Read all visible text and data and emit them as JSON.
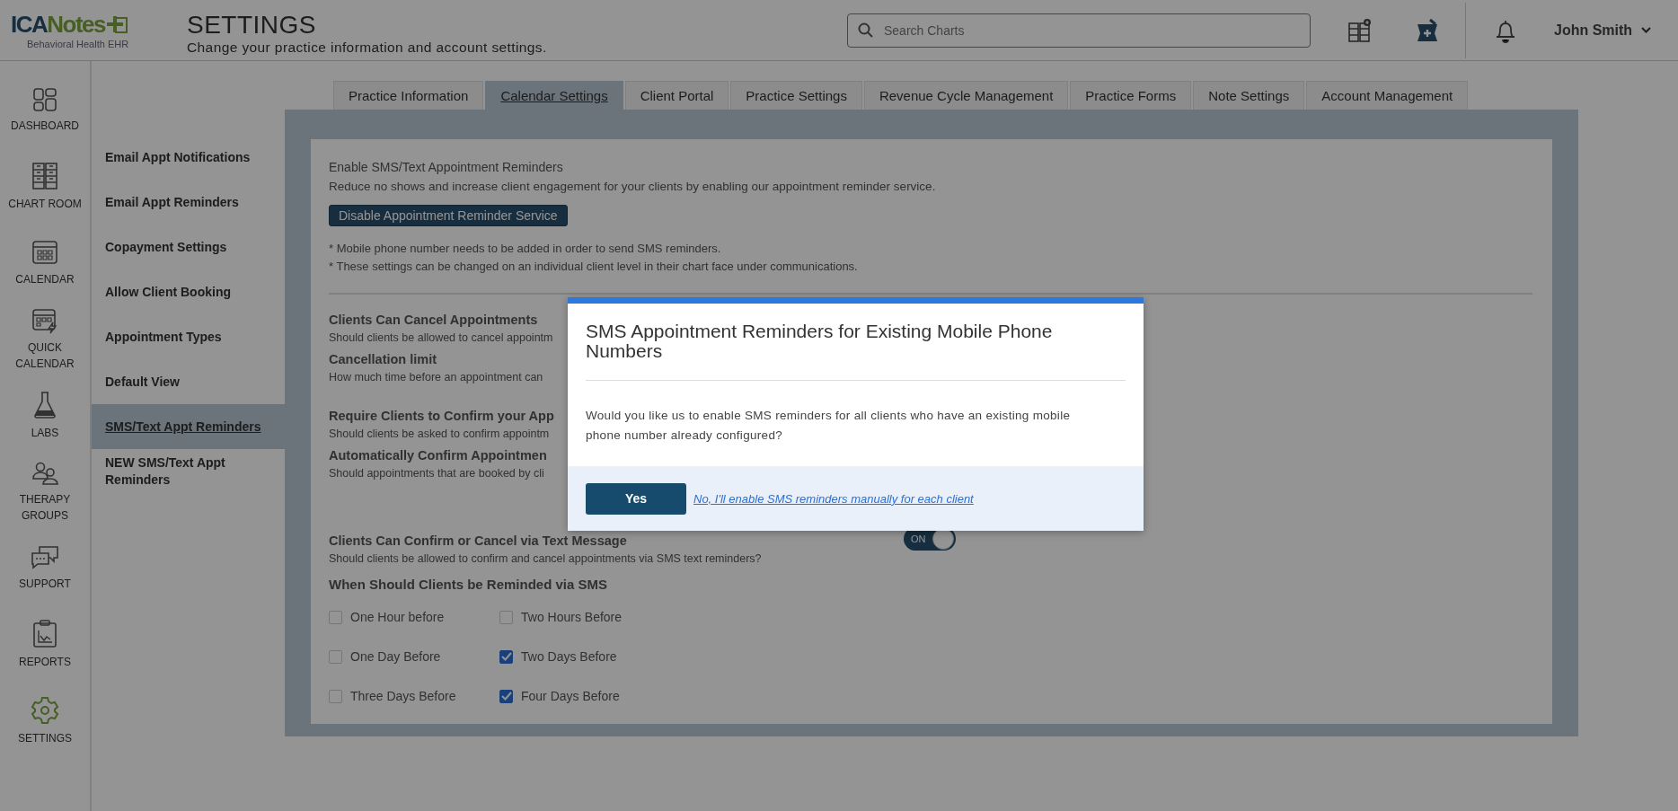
{
  "header": {
    "logo_primary": "ICA",
    "logo_secondary": "Notes",
    "tagline": "Behavioral Health EHR",
    "title": "SETTINGS",
    "subtitle": "Change your practice information and account settings.",
    "search": {
      "placeholder": "Search Charts"
    },
    "user": "John Smith"
  },
  "nav": [
    {
      "label": "DASHBOARD",
      "selected": false
    },
    {
      "label": "CHART ROOM",
      "selected": false
    },
    {
      "label": "CALENDAR",
      "selected": false
    },
    {
      "label": "QUICK CALENDAR",
      "selected": false
    },
    {
      "label": "LABS",
      "selected": false
    },
    {
      "label": "THERAPY GROUPS",
      "selected": false
    },
    {
      "label": "SUPPORT",
      "selected": false
    },
    {
      "label": "REPORTS",
      "selected": false
    },
    {
      "label": "SETTINGS",
      "selected": true
    }
  ],
  "tabs": [
    {
      "label": "Practice Information",
      "selected": false
    },
    {
      "label": "Calendar Settings",
      "selected": true
    },
    {
      "label": "Client Portal",
      "selected": false
    },
    {
      "label": "Practice Settings",
      "selected": false
    },
    {
      "label": "Revenue Cycle Management",
      "selected": false
    },
    {
      "label": "Practice Forms",
      "selected": false
    },
    {
      "label": "Note Settings",
      "selected": false
    },
    {
      "label": "Account Management",
      "selected": false
    }
  ],
  "submenu": [
    {
      "label": "Email Appt Notifications",
      "selected": false
    },
    {
      "label": "Email Appt Reminders",
      "selected": false
    },
    {
      "label": "Copayment Settings",
      "selected": false
    },
    {
      "label": "Allow Client Booking",
      "selected": false
    },
    {
      "label": "Appointment Types",
      "selected": false
    },
    {
      "label": "Default View",
      "selected": false
    },
    {
      "label": "SMS/Text Appt Reminders",
      "selected": true
    },
    {
      "label": "NEW SMS/Text Appt Reminders",
      "selected": false
    }
  ],
  "content": {
    "intro_title": "Enable SMS/Text Appointment Reminders",
    "intro_text": "Reduce no shows and increase client engagement for your clients by enabling our appointment reminder service.",
    "disable_button": "Disable Appointment Reminder Service",
    "notes": [
      "* Mobile phone number needs to be added in order to send SMS reminders.",
      "* These settings can be changed on an individual client level in their chart face under communications."
    ],
    "settings": [
      {
        "title": "Clients Can Cancel Appointments",
        "description": "Should clients be allowed to cancel appointm"
      },
      {
        "title": "Cancellation limit",
        "description": "How much time before an appointment can"
      },
      {
        "title": "Require Clients to Confirm your App",
        "description": "Should clients be asked to confirm appointm"
      },
      {
        "title": "Automatically Confirm Appointmen",
        "description": "Should appointments that are booked by cli"
      },
      {
        "title": "Clients Can Confirm or Cancel via Text Message",
        "description": "Should clients be allowed to confirm and cancel appointments via SMS text reminders?",
        "toggle": {
          "label": "ON",
          "on": true
        }
      }
    ],
    "reminder_title": "When Should Clients be Reminded via SMS",
    "reminders": [
      {
        "label": "One Hour before",
        "checked": false
      },
      {
        "label": "Two Hours Before",
        "checked": false
      },
      {
        "label": "One Day Before",
        "checked": false
      },
      {
        "label": "Two Days Before",
        "checked": true
      },
      {
        "label": "Three Days Before",
        "checked": false
      },
      {
        "label": "Four Days Before",
        "checked": true
      }
    ]
  },
  "modal": {
    "title": "SMS Appointment Reminders for Existing Mobile Phone Numbers",
    "body": "Would you like us to enable SMS reminders for all clients who have an existing mobile phone number already configured?",
    "confirm": "Yes",
    "decline": "No, I'll enable SMS reminders manually for each client"
  }
}
